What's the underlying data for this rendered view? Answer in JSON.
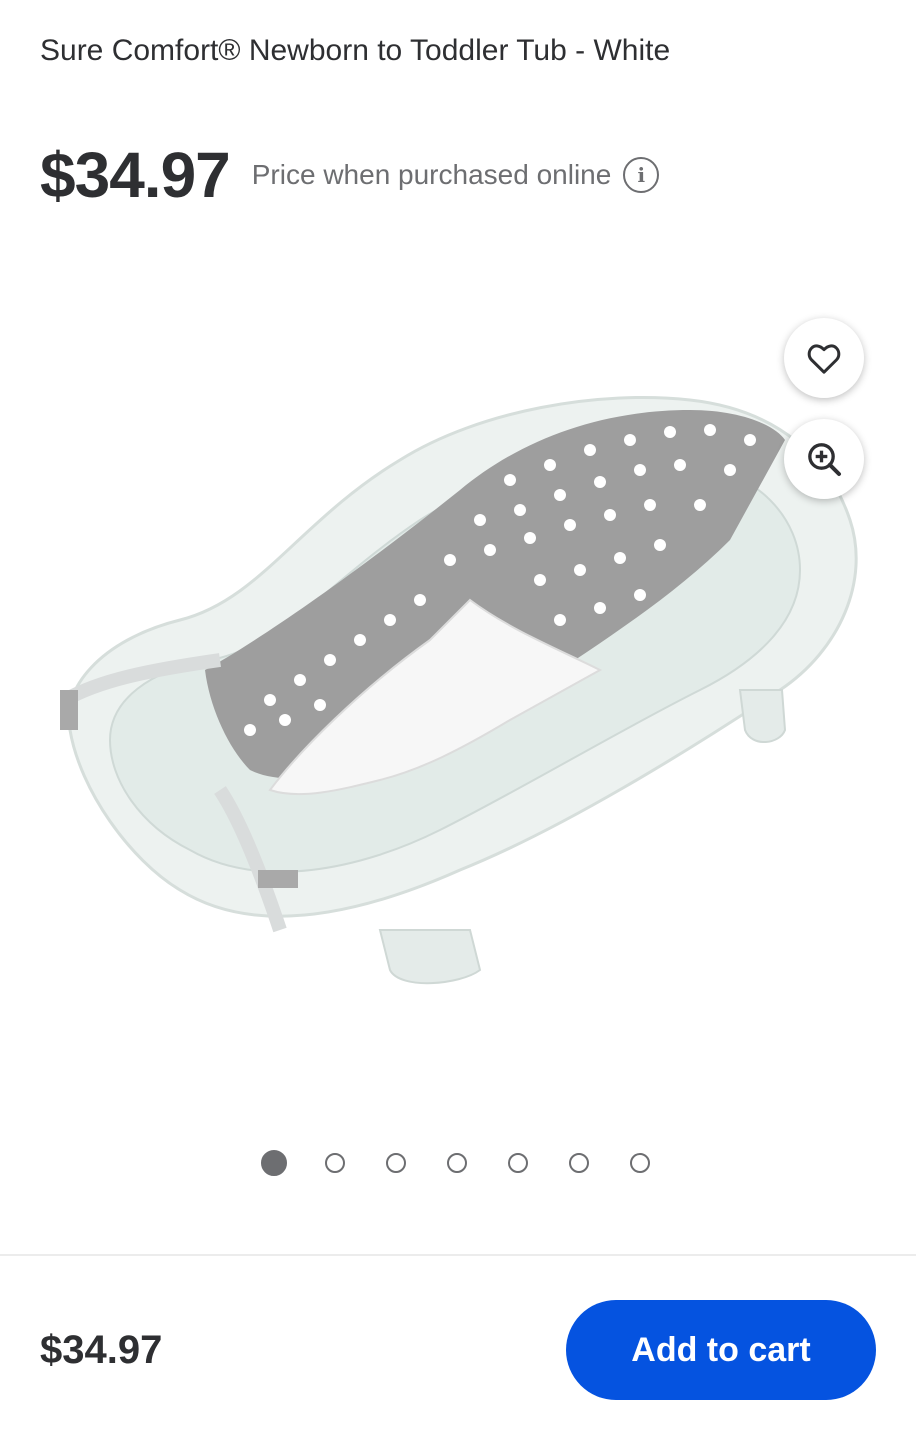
{
  "product": {
    "title": "Sure Comfort® Newborn to Toddler Tub - White",
    "price": "$34.97",
    "price_note": "Price when purchased online",
    "image_alt": "baby bath tub with gray polka-dot sling"
  },
  "actions": {
    "favorite_icon": "heart-icon",
    "zoom_icon": "zoom-in-icon",
    "info_icon": "info-icon"
  },
  "carousel": {
    "total_images": 7,
    "active_index": 0
  },
  "bottom_bar": {
    "price": "$34.97",
    "add_to_cart_label": "Add to cart"
  },
  "colors": {
    "accent": "#0553e0",
    "text": "#2e2f32",
    "muted": "#6d6e71"
  }
}
